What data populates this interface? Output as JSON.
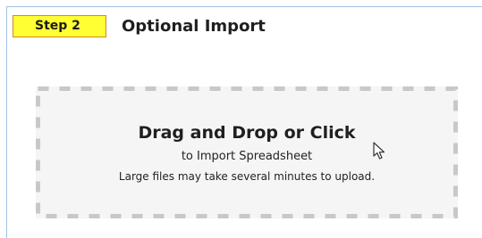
{
  "step": {
    "badge_label": "Step 2",
    "title": "Optional Import"
  },
  "dropzone": {
    "main_text": "Drag and Drop or Click",
    "sub_text": "to Import Spreadsheet",
    "note_text": "Large files may take several minutes to upload."
  },
  "colors": {
    "badge_bg": "#ffff33",
    "badge_border": "#d08a2a",
    "panel_border": "#9fc3e6",
    "dropzone_bg": "#f5f5f5",
    "dash_color": "#c8c8c8"
  },
  "icons": {
    "cursor": "mouse-pointer-icon"
  }
}
